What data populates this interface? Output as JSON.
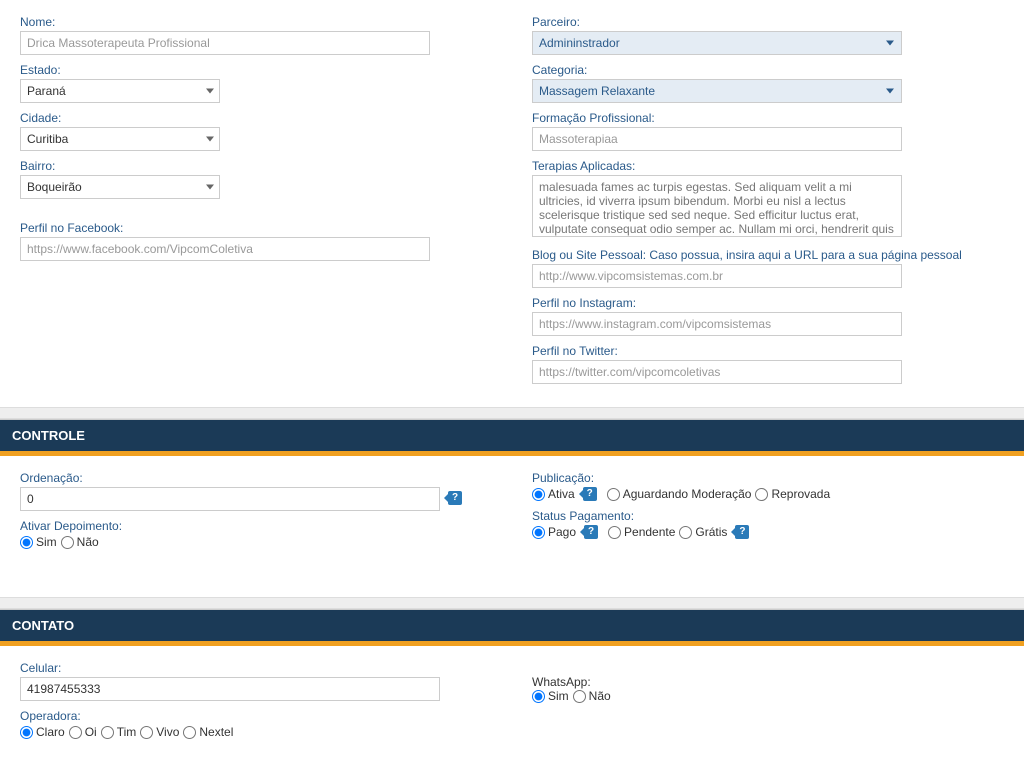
{
  "top": {
    "left": {
      "nome_label": "Nome:",
      "nome_value": "Drica Massoterapeuta Profissional",
      "estado_label": "Estado:",
      "estado_value": "Paraná",
      "cidade_label": "Cidade:",
      "cidade_value": "Curitiba",
      "bairro_label": "Bairro:",
      "bairro_value": "Boqueirão",
      "facebook_label": "Perfil no Facebook:",
      "facebook_value": "https://www.facebook.com/VipcomColetiva"
    },
    "right": {
      "parceiro_label": "Parceiro:",
      "parceiro_value": "Admininstrador",
      "categoria_label": "Categoria:",
      "categoria_value": "Massagem Relaxante",
      "formacao_label": "Formação Profissional:",
      "formacao_value": "Massoterapiaa",
      "terapias_label": "Terapias Aplicadas:",
      "terapias_value": "malesuada fames ac turpis egestas. Sed aliquam velit a mi ultricies, id viverra ipsum bibendum. Morbi eu nisl a lectus scelerisque tristique sed sed neque. Sed efficitur luctus erat, vulputate consequat odio semper ac. Nullam mi orci, hendrerit quis pellentesque eget, venenatis at eros. Duis sed faucibus mi. Cras varius pulvinar lacus ac gravida. Morbi id nunc tortor.",
      "blog_label": "Blog ou Site Pessoal: Caso possua, insira aqui a URL para a sua página pessoal",
      "blog_value": "http://www.vipcomsistemas.com.br",
      "instagram_label": "Perfil no Instagram:",
      "instagram_value": "https://www.instagram.com/vipcomsistemas",
      "twitter_label": "Perfil no Twitter:",
      "twitter_value": "https://twitter.com/vipcomcoletivas"
    }
  },
  "controle": {
    "header": "CONTROLE",
    "ordenacao_label": "Ordenação:",
    "ordenacao_value": "0",
    "depoimento_label": "Ativar Depoimento:",
    "sim": "Sim",
    "nao": "Não",
    "publicacao_label": "Publicação:",
    "pub_ativa": "Ativa",
    "pub_aguardando": "Aguardando Moderação",
    "pub_reprovada": "Reprovada",
    "status_label": "Status Pagamento:",
    "pago": "Pago",
    "pendente": "Pendente",
    "gratis": "Grátis",
    "help": "?"
  },
  "contato": {
    "header": "CONTATO",
    "celular_label": "Celular:",
    "celular_value": "41987455333",
    "operadora_label": "Operadora:",
    "claro": "Claro",
    "oi": "Oi",
    "tim": "Tim",
    "vivo": "Vivo",
    "nextel": "Nextel",
    "whatsapp_label": "WhatsApp:",
    "sim": "Sim",
    "nao": "Não"
  }
}
